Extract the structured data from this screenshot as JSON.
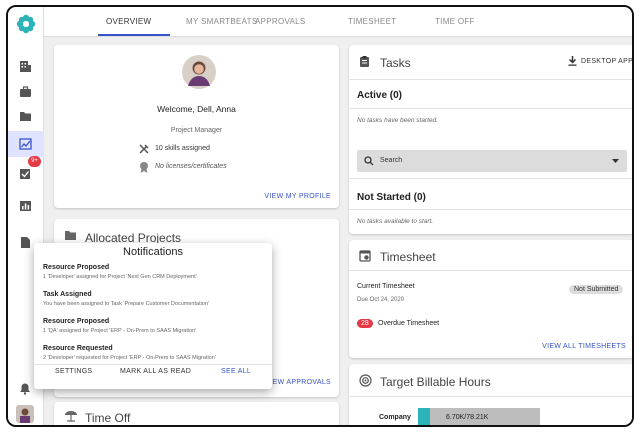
{
  "nav": {
    "tabs": [
      {
        "label": "OVERVIEW"
      },
      {
        "label": "MY SMARTBEATS"
      },
      {
        "label": "APPROVALS"
      },
      {
        "label": "TIMESHEET"
      },
      {
        "label": "TIME OFF"
      }
    ]
  },
  "rail": {
    "badge": "9+"
  },
  "profile": {
    "welcome": "Welcome, Dell, Anna",
    "role": "Project Manager",
    "skills": "10 skills assigned",
    "licenses": "No licenses/certificates",
    "view_profile": "VIEW MY PROFILE"
  },
  "allocated": {
    "title": "Allocated Projects",
    "view_approvals": "VIEW APPROVALS"
  },
  "timeoff": {
    "title": "Time Off"
  },
  "notifications": {
    "title": "Notifications",
    "items": [
      {
        "title": "Resource Proposed",
        "detail": "1 'Developer' assigned for Project 'Next Gen CRM Deployment'"
      },
      {
        "title": "Task Assigned",
        "detail": "You have been assigned to Task 'Prepare Customer Documentation'"
      },
      {
        "title": "Resource Proposed",
        "detail": "1 'QA' assigned for Project 'ERP - On-Prem to SAAS Migration'"
      },
      {
        "title": "Resource Requested",
        "detail": "2 'Developer' requested for Project 'ERP - On-Prem to SAAS Migration'"
      }
    ],
    "settings": "SETTINGS",
    "mark_all": "MARK ALL AS READ",
    "see_all": "SEE ALL"
  },
  "tasks": {
    "title": "Tasks",
    "desktop_app": "DESKTOP APP",
    "active": "Active (0)",
    "active_empty": "No tasks have been started.",
    "search_label": "Search",
    "not_started": "Not Started (0)",
    "not_started_empty": "No tasks available to start."
  },
  "timesheet": {
    "title": "Timesheet",
    "current": "Current Timesheet",
    "due": "Due Oct 24, 2020",
    "status": "Not Submitted",
    "overdue_count": "28",
    "overdue_label": "Overdue Timesheet",
    "view_all": "VIEW ALL TIMESHEETS"
  },
  "billable": {
    "title": "Target Billable Hours",
    "row_label": "Company",
    "value_text": "6.70K/78.21K",
    "fraction": 0.0857
  },
  "colors": {
    "accent": "#3754c7",
    "teal": "#2bb3b8",
    "badge": "#e53946"
  }
}
